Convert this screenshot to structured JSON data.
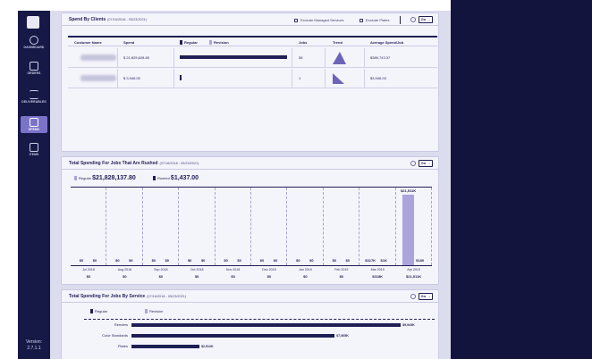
{
  "sidebar": {
    "items": [
      {
        "label": "DASHBOARD",
        "icon": "dashboard-icon"
      },
      {
        "label": "ORDERS",
        "icon": "orders-icon"
      },
      {
        "label": "DELIVERABLES",
        "icon": "deliverables-icon"
      },
      {
        "label": "SPEND",
        "icon": "spend-icon",
        "active": true
      },
      {
        "label": "ITEMS",
        "icon": "items-icon"
      }
    ],
    "version_label": "Version:",
    "version_number": "2.7.1.1"
  },
  "spend_by_clients": {
    "title": "Spend By Clients",
    "range": "(07/16/2018 - 05/23/2021)",
    "exclude_managed": "Exclude Managed Services",
    "exclude_plates": "Exclude Plates",
    "go_label": "Go →",
    "columns": {
      "customer": "Customer Name",
      "spend": "Spend",
      "regular": "Regular",
      "revision": "Revision",
      "jobs": "Jobs",
      "trend": "Trend",
      "avg": "Average Spend/Job"
    },
    "rows": [
      {
        "spend": "$ 21,825,628.80",
        "jobs": "56",
        "avg": "$389,743.37",
        "bar_fraction": 1.0
      },
      {
        "spend": "$ 3,946.00",
        "jobs": "1",
        "avg": "$3,946.00",
        "bar_fraction": 0.01
      }
    ]
  },
  "rushed": {
    "title": "Total Spending For Jobs That Are Rushed",
    "range": "(07/16/2018 - 05/23/2021)",
    "go_label": "Go →",
    "regular_label": "Regular",
    "regular_total": "$21,828,137.80",
    "rushed_label": "Rushed",
    "rushed_total": "$1,437.00",
    "months": [
      {
        "month": "Jul 2018",
        "regular": "$0",
        "rushed": "$0",
        "total": "$0"
      },
      {
        "month": "Aug 2018",
        "regular": "$0",
        "rushed": "$0",
        "total": "$0"
      },
      {
        "month": "Sep 2018",
        "regular": "$0",
        "rushed": "$0",
        "total": "$0"
      },
      {
        "month": "Oct 2018",
        "regular": "$0",
        "rushed": "$0",
        "total": "$0"
      },
      {
        "month": "Nov 2018",
        "regular": "$0",
        "rushed": "$0",
        "total": "$0"
      },
      {
        "month": "Dec 2018",
        "regular": "$0",
        "rushed": "$0",
        "total": "$0"
      },
      {
        "month": "Jan 2019",
        "regular": "$0",
        "rushed": "$0",
        "total": "$0"
      },
      {
        "month": "Feb 2019",
        "regular": "$0",
        "rushed": "$0",
        "total": "$0"
      },
      {
        "month": "Mar 2019",
        "regular": "$317K",
        "rushed": "$1K",
        "total": "$318K"
      },
      {
        "month": "Apr 2019",
        "regular": "$21,511K",
        "rushed": "$180",
        "total": "$21,511K"
      }
    ]
  },
  "by_service": {
    "title": "Total Spending For Jobs By Service",
    "range": "(07/16/2018 - 05/23/2021)",
    "go_label": "Go →",
    "regular_label": "Regular",
    "revision_label": "Revision",
    "services": [
      {
        "name": "Renders",
        "value": "$9,943K",
        "amount": 9943
      },
      {
        "name": "Color Standards",
        "value": "$7,505K",
        "amount": 7505
      },
      {
        "name": "Plates",
        "value": "$2,512K",
        "amount": 2512
      }
    ]
  },
  "colors": {
    "sidebar": "#161846",
    "accent": "#1f1f55",
    "bar_light": "#aaa3dc",
    "page_bg": "#dcdcef"
  }
}
